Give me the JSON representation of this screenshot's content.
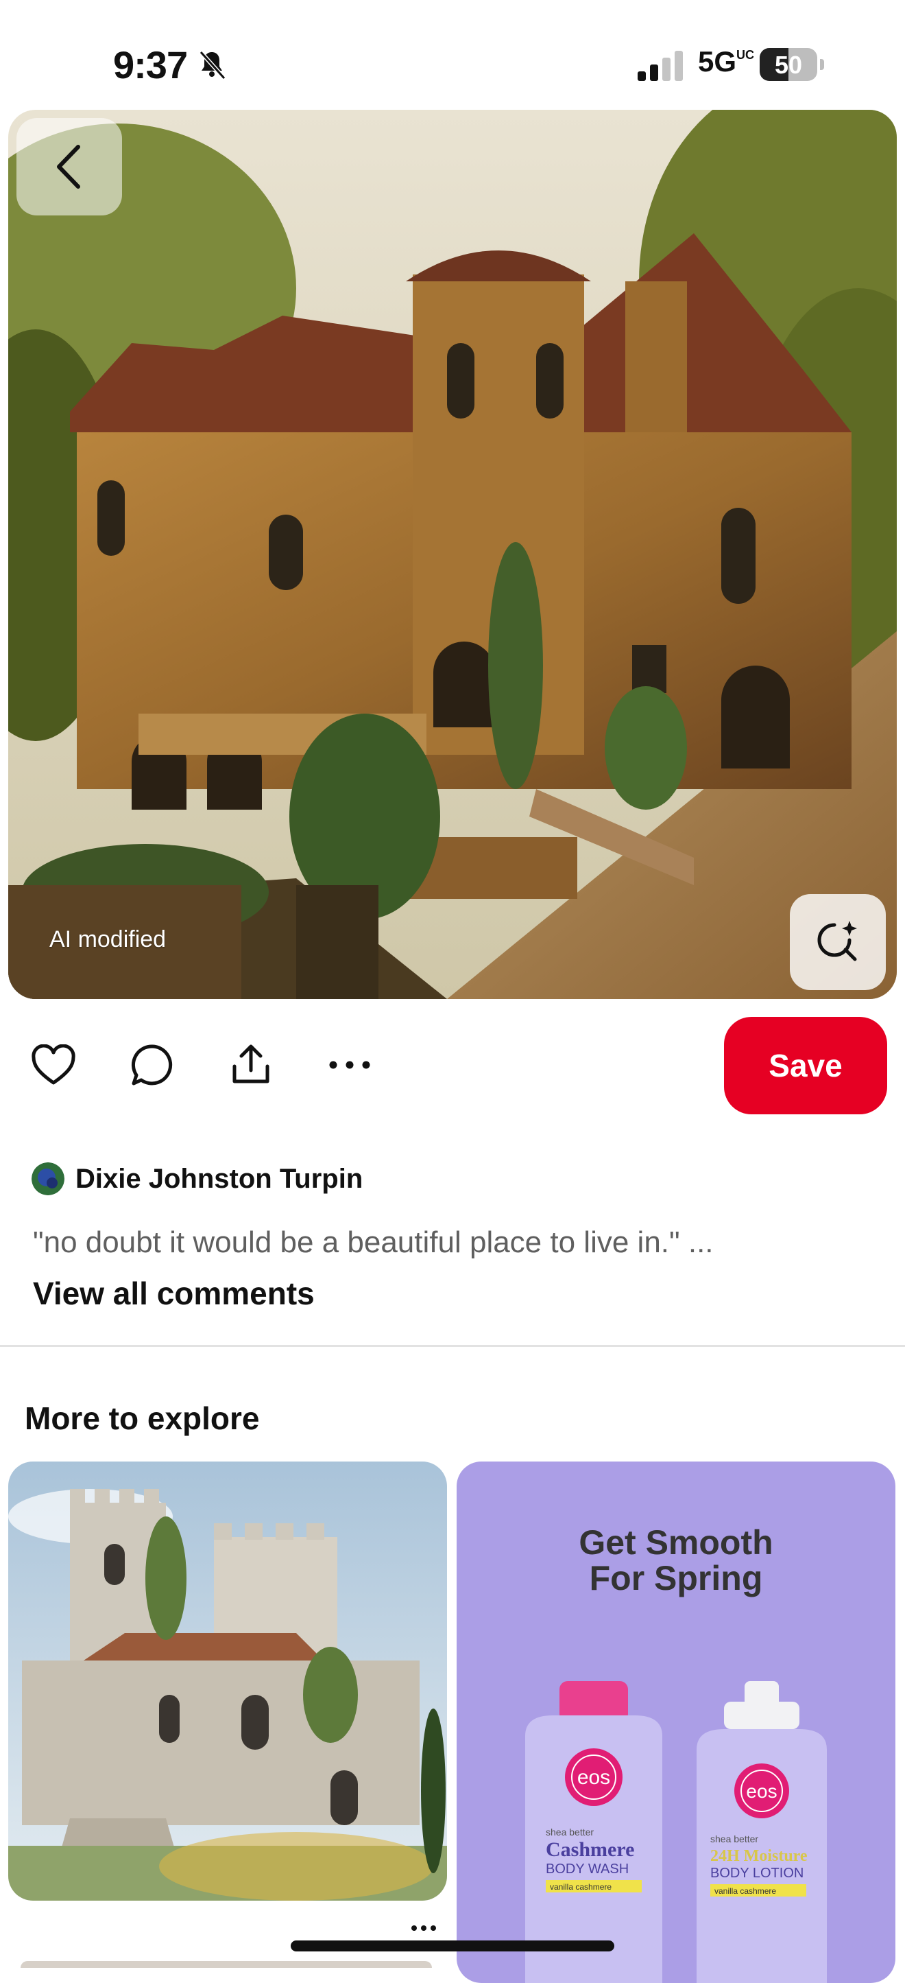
{
  "status_bar": {
    "time": "9:37",
    "network": "5G",
    "network_sup": "UC",
    "battery": "50",
    "battery_level": 0.5,
    "bell_icon": "bell-slash-icon",
    "signal_icon": "cellular-signal-icon"
  },
  "pin": {
    "badge": "AI modified",
    "back_icon": "chevron-left-icon",
    "lens_icon": "visual-search-icon"
  },
  "actions": {
    "like_icon": "heart-icon",
    "comment_icon": "comment-bubble-icon",
    "share_icon": "share-icon",
    "more_icon": "more-horizontal-icon",
    "save_label": "Save",
    "save_color": "#e60023"
  },
  "comments": {
    "author": "Dixie Johnston Turpin",
    "text": "\"no doubt it would be a beautiful place to live in.\" ...",
    "view_all": "View all comments"
  },
  "explore": {
    "title": "More to explore",
    "ad": {
      "headline_line1": "Get Smooth",
      "headline_line2": "For Spring",
      "brand": "eos",
      "product1_line1": "shea better",
      "product1_name": "Cashmere",
      "product1_type": "BODY WASH",
      "product1_scent": "vanilla cashmere",
      "product2_line1": "shea better",
      "product2_name": "24H Moisture",
      "product2_type": "BODY LOTION",
      "product2_scent": "vanilla cashmere",
      "background": "#ab9ee6"
    }
  }
}
